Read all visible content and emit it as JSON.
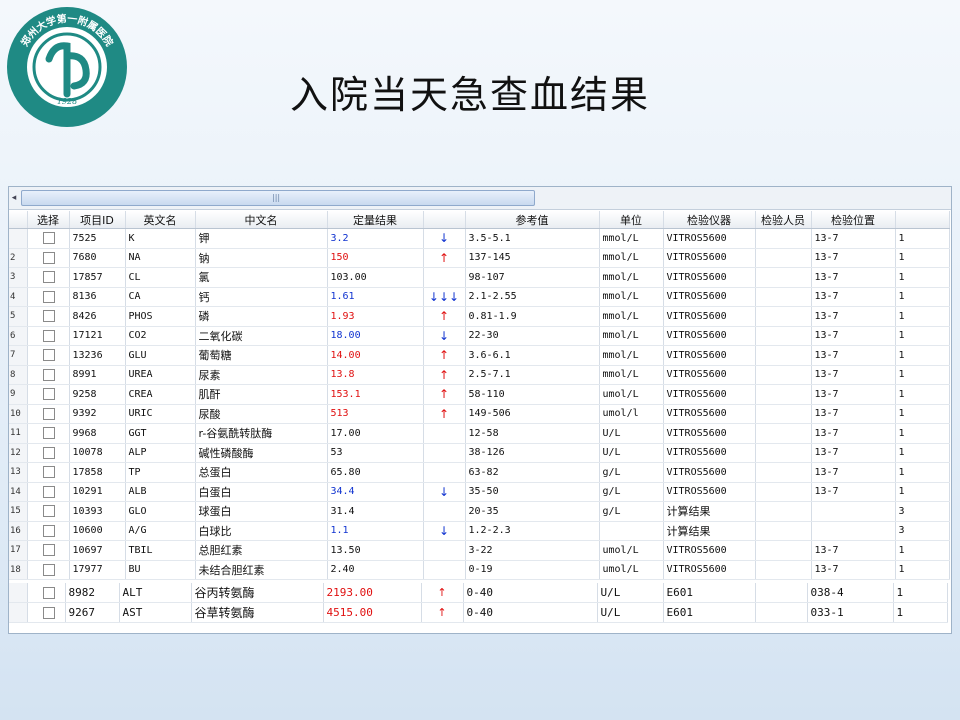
{
  "slide": {
    "title": "入院当天急查血结果",
    "logo": {
      "text": "郑州大学第一附属医院",
      "year": "1928"
    }
  },
  "grid": {
    "columns": [
      "选择",
      "项目ID",
      "英文名",
      "中文名",
      "定量结果",
      "",
      "参考值",
      "单位",
      "检验仪器",
      "检验人员",
      "检验位置",
      ""
    ],
    "rows": [
      {
        "rn": "",
        "id": "7525",
        "en": "K",
        "cn": "钾",
        "result": "3.2",
        "color": "blue",
        "flag": "↓",
        "ref": "3.5-5.1",
        "unit": "mmol/L",
        "device": "VITROS5600",
        "staff": "",
        "pos": "13-7",
        "n": "1"
      },
      {
        "rn": "2",
        "id": "7680",
        "en": "NA",
        "cn": "钠",
        "result": "150",
        "color": "red",
        "flag": "↑",
        "ref": "137-145",
        "unit": "mmol/L",
        "device": "VITROS5600",
        "staff": "",
        "pos": "13-7",
        "n": "1"
      },
      {
        "rn": "3",
        "id": "17857",
        "en": "CL",
        "cn": "氯",
        "result": "103.00",
        "color": "",
        "flag": "",
        "ref": "98-107",
        "unit": "mmol/L",
        "device": "VITROS5600",
        "staff": "",
        "pos": "13-7",
        "n": "1"
      },
      {
        "rn": "4",
        "id": "8136",
        "en": "CA",
        "cn": "钙",
        "result": "1.61",
        "color": "blue",
        "flag": "↓↓↓",
        "ref": "2.1-2.55",
        "unit": "mmol/L",
        "device": "VITROS5600",
        "staff": "",
        "pos": "13-7",
        "n": "1"
      },
      {
        "rn": "5",
        "id": "8426",
        "en": "PHOS",
        "cn": "磷",
        "result": "1.93",
        "color": "red",
        "flag": "↑",
        "ref": "0.81-1.9",
        "unit": "mmol/L",
        "device": "VITROS5600",
        "staff": "",
        "pos": "13-7",
        "n": "1"
      },
      {
        "rn": "6",
        "id": "17121",
        "en": "CO2",
        "cn": "二氧化碳",
        "result": "18.00",
        "color": "blue",
        "flag": "↓",
        "ref": "22-30",
        "unit": "mmol/L",
        "device": "VITROS5600",
        "staff": "",
        "pos": "13-7",
        "n": "1"
      },
      {
        "rn": "7",
        "id": "13236",
        "en": "GLU",
        "cn": "葡萄糖",
        "result": "14.00",
        "color": "red",
        "flag": "↑",
        "ref": "3.6-6.1",
        "unit": "mmol/L",
        "device": "VITROS5600",
        "staff": "",
        "pos": "13-7",
        "n": "1"
      },
      {
        "rn": "8",
        "id": "8991",
        "en": "UREA",
        "cn": "尿素",
        "result": "13.8",
        "color": "red",
        "flag": "↑",
        "ref": "2.5-7.1",
        "unit": "mmol/L",
        "device": "VITROS5600",
        "staff": "",
        "pos": "13-7",
        "n": "1"
      },
      {
        "rn": "9",
        "id": "9258",
        "en": "CREA",
        "cn": "肌酐",
        "result": "153.1",
        "color": "red",
        "flag": "↑",
        "ref": "58-110",
        "unit": "umol/L",
        "device": "VITROS5600",
        "staff": "",
        "pos": "13-7",
        "n": "1"
      },
      {
        "rn": "10",
        "id": "9392",
        "en": "URIC",
        "cn": "尿酸",
        "result": "513",
        "color": "red",
        "flag": "↑",
        "ref": "149-506",
        "unit": "umol/l",
        "device": "VITROS5600",
        "staff": "",
        "pos": "13-7",
        "n": "1"
      },
      {
        "rn": "11",
        "id": "9968",
        "en": "GGT",
        "cn": "r-谷氨酰转肽酶",
        "result": "17.00",
        "color": "",
        "flag": "",
        "ref": "12-58",
        "unit": "U/L",
        "device": "VITROS5600",
        "staff": "",
        "pos": "13-7",
        "n": "1"
      },
      {
        "rn": "12",
        "id": "10078",
        "en": "ALP",
        "cn": "碱性磷酸酶",
        "result": "53",
        "color": "",
        "flag": "",
        "ref": "38-126",
        "unit": "U/L",
        "device": "VITROS5600",
        "staff": "",
        "pos": "13-7",
        "n": "1"
      },
      {
        "rn": "13",
        "id": "17858",
        "en": "TP",
        "cn": "总蛋白",
        "result": "65.80",
        "color": "",
        "flag": "",
        "ref": "63-82",
        "unit": "g/L",
        "device": "VITROS5600",
        "staff": "",
        "pos": "13-7",
        "n": "1"
      },
      {
        "rn": "14",
        "id": "10291",
        "en": "ALB",
        "cn": "白蛋白",
        "result": "34.4",
        "color": "blue",
        "flag": "↓",
        "ref": "35-50",
        "unit": "g/L",
        "device": "VITROS5600",
        "staff": "",
        "pos": "13-7",
        "n": "1"
      },
      {
        "rn": "15",
        "id": "10393",
        "en": "GLO",
        "cn": "球蛋白",
        "result": "31.4",
        "color": "",
        "flag": "",
        "ref": "20-35",
        "unit": "g/L",
        "device": "计算结果",
        "staff": "",
        "pos": "",
        "n": "3"
      },
      {
        "rn": "16",
        "id": "10600",
        "en": "A/G",
        "cn": "白球比",
        "result": "1.1",
        "color": "blue",
        "flag": "↓",
        "ref": "1.2-2.3",
        "unit": "",
        "device": "计算结果",
        "staff": "",
        "pos": "",
        "n": "3"
      },
      {
        "rn": "17",
        "id": "10697",
        "en": "TBIL",
        "cn": "总胆红素",
        "result": "13.50",
        "color": "",
        "flag": "",
        "ref": "3-22",
        "unit": "umol/L",
        "device": "VITROS5600",
        "staff": "",
        "pos": "13-7",
        "n": "1"
      },
      {
        "rn": "18",
        "id": "17977",
        "en": "BU",
        "cn": "未结合胆红素",
        "result": "2.40",
        "color": "",
        "flag": "",
        "ref": "0-19",
        "unit": "umol/L",
        "device": "VITROS5600",
        "staff": "",
        "pos": "13-7",
        "n": "1"
      }
    ]
  },
  "extra_rows": [
    {
      "id": "8982",
      "en": "ALT",
      "cn": "谷丙转氨酶",
      "result": "2193.00",
      "color": "red",
      "flag": "↑",
      "ref": "0-40",
      "unit": "U/L",
      "device": "E601",
      "staff": "",
      "pos": "038-4",
      "n": "1"
    },
    {
      "id": "9267",
      "en": "AST",
      "cn": "谷草转氨酶",
      "result": "4515.00",
      "color": "red",
      "flag": "↑",
      "ref": "0-40",
      "unit": "U/L",
      "device": "E601",
      "staff": "",
      "pos": "033-1",
      "n": "1"
    }
  ],
  "colors": {
    "high": "#e01010",
    "low": "#1033d0",
    "logo": "#1f8a84"
  }
}
